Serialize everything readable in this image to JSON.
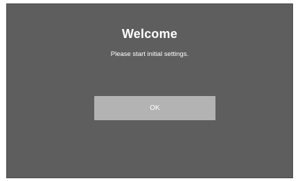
{
  "dialog": {
    "title": "Welcome",
    "message": "Please start initial settings.",
    "ok_label": "OK"
  }
}
